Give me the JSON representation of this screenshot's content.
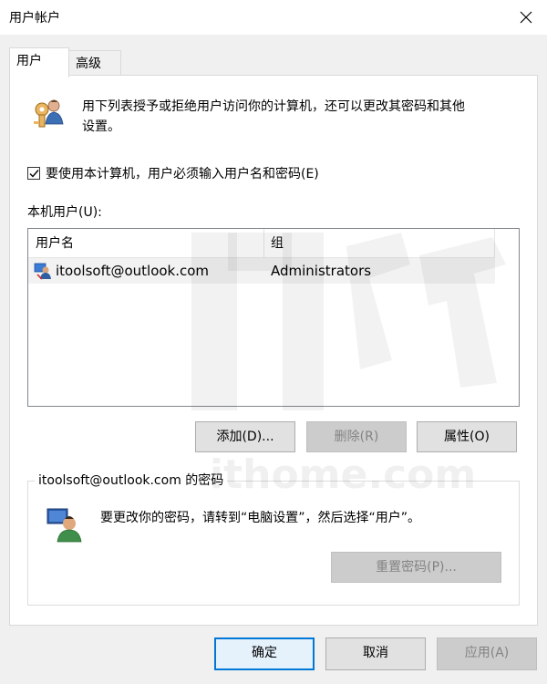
{
  "window": {
    "title": "用户帐户",
    "close_icon": "close-icon"
  },
  "tabs": [
    {
      "label": "用户",
      "active": true
    },
    {
      "label": "高级",
      "active": false
    }
  ],
  "intro": {
    "icon": "users-keys-icon",
    "text_line1": "用下列表授予或拒绝用户访问你的计算机，还可以更改其密码和其他",
    "text_line2": "设置。"
  },
  "require_password": {
    "checked": true,
    "label": "要使用本计算机，用户必须输入用户名和密码(E)"
  },
  "users_list": {
    "label": "本机用户(U):",
    "columns": [
      "用户名",
      "组"
    ],
    "rows": [
      {
        "icon": "user-account-icon",
        "username": "itoolsoft@outlook.com",
        "group": "Administrators"
      }
    ]
  },
  "user_buttons": {
    "add": "添加(D)...",
    "remove": "删除(R)",
    "properties": "属性(O)"
  },
  "password_group": {
    "title": "itoolsoft@outlook.com 的密码",
    "icon": "user-monitor-icon",
    "text": "要更改你的密码，请转到“电脑设置”，然后选择“用户”。",
    "reset_button": "重置密码(P)..."
  },
  "dialog_buttons": {
    "ok": "确定",
    "cancel": "取消",
    "apply": "应用(A)"
  },
  "watermark": {
    "text": "ithome.com"
  },
  "colors": {
    "accent": "#0078d7",
    "title_bar": "#ffffff",
    "dialog_bg": "#f0f0f0",
    "disabled_text": "#838383"
  }
}
